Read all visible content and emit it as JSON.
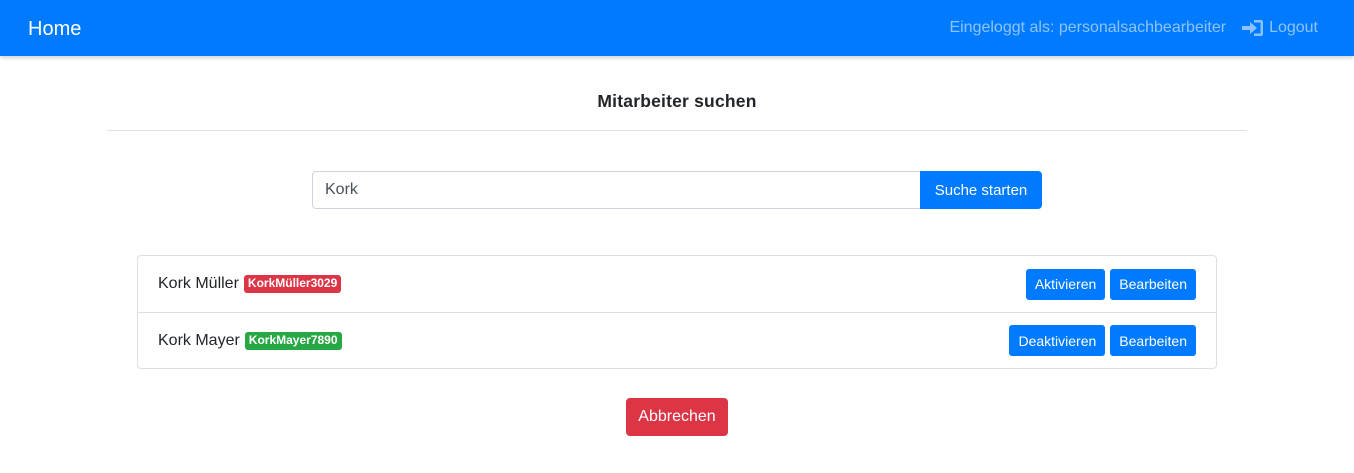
{
  "navbar": {
    "brand": "Home",
    "logged_in_text": "Eingeloggt als: personalsachbearbeiter",
    "logout_label": "Logout",
    "logout_icon": "sign-in-icon",
    "background": "#007bff"
  },
  "page": {
    "title": "Mitarbeiter suchen"
  },
  "search": {
    "value": "Kork",
    "button_label": "Suche starten"
  },
  "results": [
    {
      "name": "Kork Müller",
      "badge": "KorkMüller3029",
      "badge_color": "#dc3545",
      "toggle_label": "Aktivieren",
      "edit_label": "Bearbeiten"
    },
    {
      "name": "Kork Mayer",
      "badge": "KorkMayer7890",
      "badge_color": "#28a745",
      "toggle_label": "Deaktivieren",
      "edit_label": "Bearbeiten"
    }
  ],
  "footer": {
    "cancel_label": "Abbrechen",
    "cancel_color": "#dc3545"
  }
}
